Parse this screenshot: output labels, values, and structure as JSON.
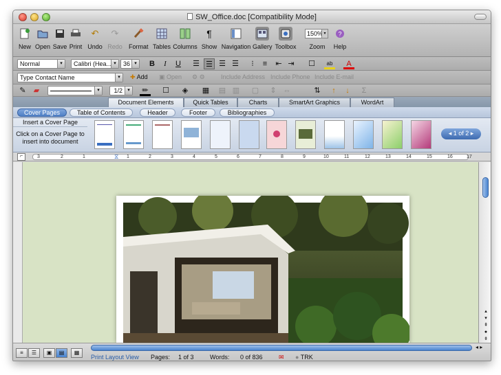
{
  "window": {
    "title": "SW_Office.doc [Compatibility Mode]"
  },
  "toolbar": {
    "new": "New",
    "open": "Open",
    "save": "Save",
    "print": "Print",
    "undo": "Undo",
    "redo": "Redo",
    "format": "Format",
    "tables": "Tables",
    "columns": "Columns",
    "show": "Show",
    "navigation": "Navigation",
    "gallery": "Gallery",
    "toolbox": "Toolbox",
    "zoom": "Zoom",
    "zoom_value": "150%",
    "help": "Help"
  },
  "format": {
    "style": "Normal",
    "font": "Calibri (Hea...",
    "size": "36",
    "bold": "B",
    "italic": "I",
    "underline": "U"
  },
  "contact": {
    "type": "Type Contact Name",
    "add": "Add",
    "open": "Open",
    "include_address": "Include Address",
    "include_phone": "Include Phone",
    "include_email": "Include E-mail"
  },
  "drawing": {
    "line_weight": "1/2"
  },
  "ribbon": {
    "tabs": [
      "Document Elements",
      "Quick Tables",
      "Charts",
      "SmartArt Graphics",
      "WordArt"
    ],
    "subtabs": [
      "Cover Pages",
      "Table of Contents",
      "Header",
      "Footer",
      "Bibliographies"
    ],
    "gallery_heading": "Insert a Cover Page",
    "gallery_desc": "Click on a Cover Page to insert into document",
    "pager": "1 of 2"
  },
  "ruler": {
    "numbers": [
      "3",
      "2",
      "1",
      "1",
      "2",
      "3",
      "4",
      "5",
      "6",
      "7",
      "8",
      "9",
      "10",
      "11",
      "12",
      "13",
      "14",
      "15",
      "16",
      "17"
    ]
  },
  "status": {
    "view": "Print Layout View",
    "pages_label": "Pages:",
    "pages_value": "1 of 3",
    "words_label": "Words:",
    "words_value": "0 of 836",
    "trk": "TRK"
  },
  "colors": {
    "ribbon_accent": "#4f7fc5",
    "doc_background": "#d8e3c5"
  }
}
